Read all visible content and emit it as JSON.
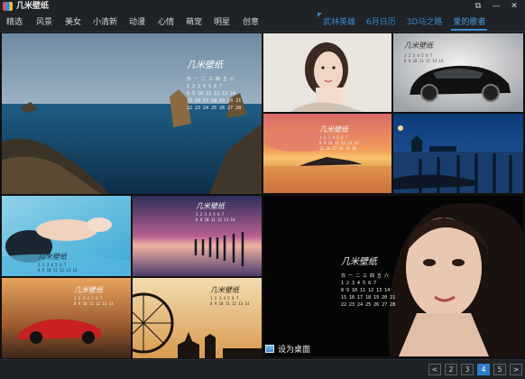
{
  "app": {
    "title": "几米壁纸"
  },
  "window_buttons": [
    "⧉",
    "—",
    "✕"
  ],
  "nav": {
    "items": [
      "精选",
      "风景",
      "美女",
      "小清新",
      "动漫",
      "心情",
      "萌宠",
      "明星",
      "创意"
    ]
  },
  "tabs": [
    {
      "label": "武林英雄",
      "active": false
    },
    {
      "label": "6月日历",
      "active": false
    },
    {
      "label": "3D马之路",
      "active": false
    },
    {
      "label": "爱的歌者",
      "active": true
    }
  ],
  "tiles": [
    {
      "name": "coastal-rocks-calendar"
    },
    {
      "name": "woman-portrait"
    },
    {
      "name": "black-supercar"
    },
    {
      "name": "sunset-island-calendar"
    },
    {
      "name": "venice-gondolas"
    },
    {
      "name": "pool-woman-calendar"
    },
    {
      "name": "pier-sunset-calendar"
    },
    {
      "name": "star-portrait-calendar"
    },
    {
      "name": "red-car-calendar"
    },
    {
      "name": "ferris-wheel-calendar"
    }
  ],
  "set_desktop": {
    "label": "设为桌面"
  },
  "pager": {
    "prev": "<",
    "pages": [
      "2",
      "3",
      "4",
      "5"
    ],
    "active": "4",
    "next": ">"
  },
  "colors": {
    "accent": "#3a8ad3",
    "background": "#1b1d21"
  }
}
